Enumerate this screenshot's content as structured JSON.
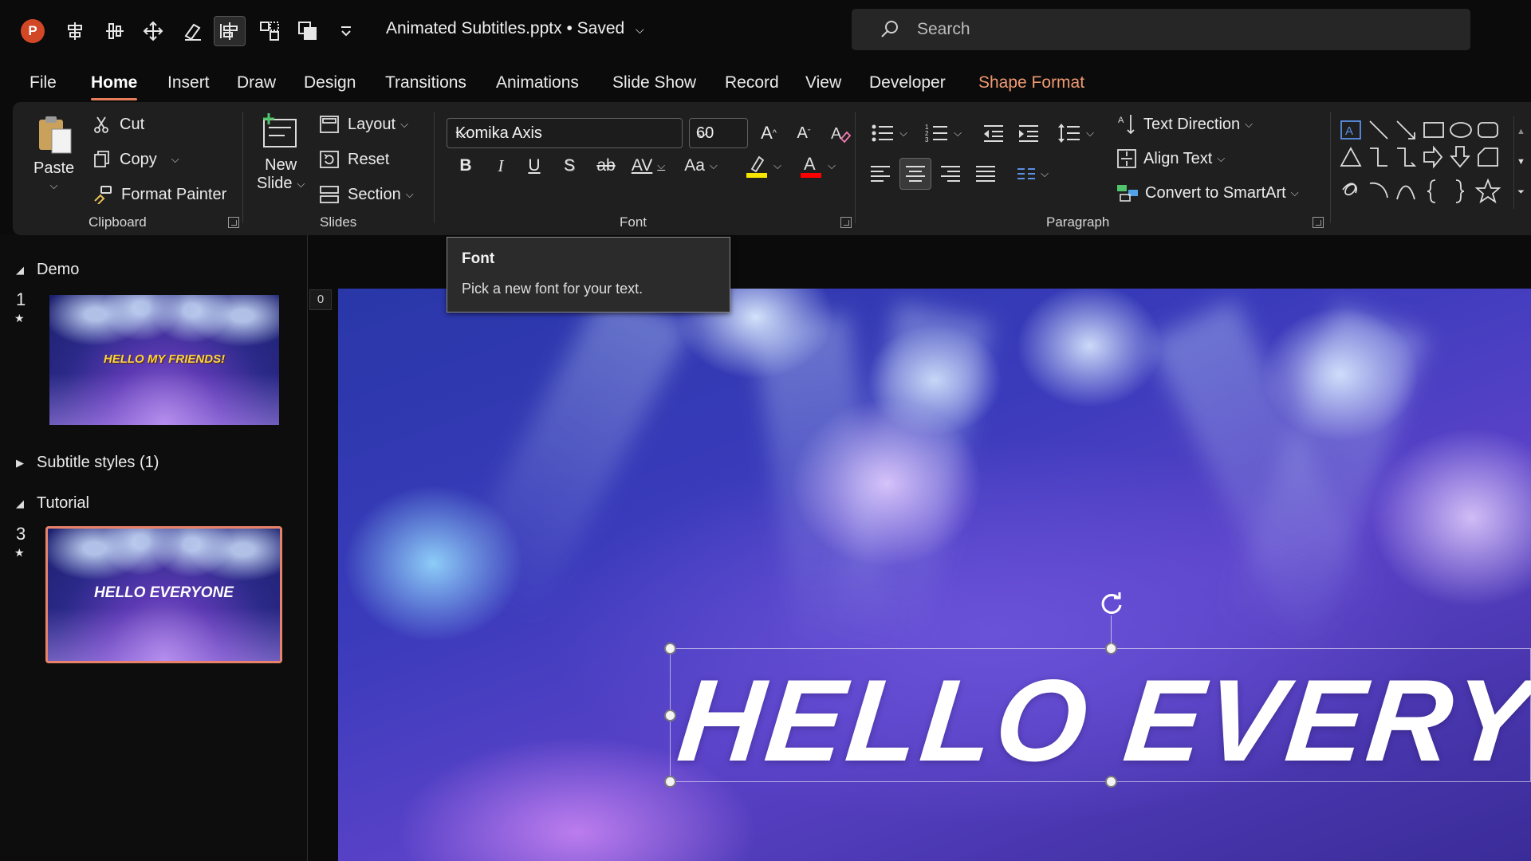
{
  "app": {
    "logo_letter": "P",
    "document_title": "Animated Subtitles.pptx • Saved",
    "search_placeholder": "Search"
  },
  "quick_access_icons": [
    "align-center-icon",
    "distribute-icon",
    "move-icon",
    "edit-shape-icon",
    "align-selected-icon",
    "group-objects-icon",
    "arrange-icon",
    "customize-qat-icon"
  ],
  "tabs": [
    {
      "label": "File"
    },
    {
      "label": "Home",
      "active": true
    },
    {
      "label": "Insert"
    },
    {
      "label": "Draw"
    },
    {
      "label": "Design"
    },
    {
      "label": "Transitions"
    },
    {
      "label": "Animations"
    },
    {
      "label": "Slide Show"
    },
    {
      "label": "Record"
    },
    {
      "label": "View"
    },
    {
      "label": "Developer"
    },
    {
      "label": "Shape Format",
      "contextual": true
    }
  ],
  "ribbon": {
    "clipboard": {
      "paste": "Paste",
      "cut": "Cut",
      "copy": "Copy",
      "format_painter": "Format Painter",
      "group_label": "Clipboard"
    },
    "slides": {
      "new_slide_line1": "New",
      "new_slide_line2": "Slide",
      "layout": "Layout",
      "reset": "Reset",
      "section": "Section",
      "group_label": "Slides"
    },
    "font": {
      "font_name": "Komika Axis",
      "font_size": "60",
      "bold": "B",
      "italic": "I",
      "underline": "U",
      "shadow": "S",
      "strikethrough": "ab",
      "char_spacing": "AV",
      "change_case": "Aa",
      "group_label": "Font",
      "highlight_color": "#f5e500",
      "font_color": "#ff0000"
    },
    "paragraph": {
      "text_direction": "Text Direction",
      "align_text": "Align Text",
      "convert_smartart": "Convert to SmartArt",
      "group_label": "Paragraph"
    }
  },
  "tooltip": {
    "title": "Font",
    "description": "Pick a new font for your text."
  },
  "slide_panel": {
    "sections": [
      {
        "name": "Demo",
        "expanded": true
      },
      {
        "name": "Subtitle styles (1)",
        "expanded": false
      },
      {
        "name": "Tutorial",
        "expanded": true
      }
    ],
    "slides": [
      {
        "number": "1",
        "thumb_text": "HELLO MY FRIENDS!",
        "has_animation": true,
        "selected": false
      },
      {
        "number": "3",
        "thumb_text": "HELLO EVERYONE",
        "has_animation": true,
        "selected": true
      }
    ]
  },
  "canvas": {
    "ruler_label": "0",
    "headline": "HELLO EVERYONE"
  },
  "colors": {
    "accent": "#e67e5a",
    "contextual_tab": "#ef9a73",
    "selected_thumb_border": "#e8836a"
  }
}
